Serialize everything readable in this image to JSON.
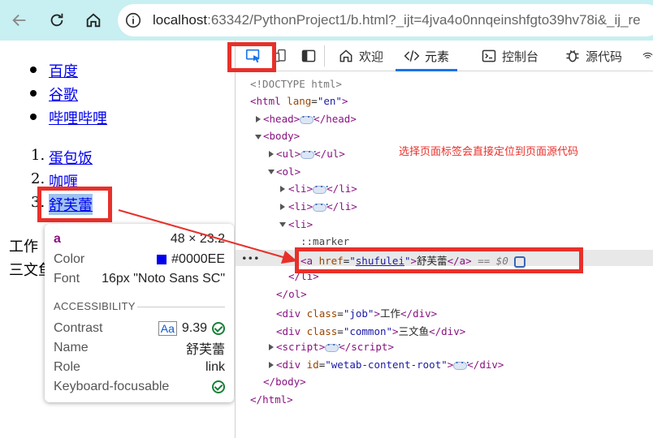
{
  "browser": {
    "url_host": "localhost",
    "url_rest": ":63342/PythonProject1/b.html?_ijt=4jva4o0nnqeinshfgto39hv78i&_ij_re"
  },
  "page": {
    "ul_items": [
      "百度",
      "谷歌",
      "哔哩哔哩"
    ],
    "ol_items": [
      {
        "num": "1.",
        "label": "蛋包饭"
      },
      {
        "num": "2.",
        "label": "咖喱"
      },
      {
        "num": "3.",
        "label": "舒芙蕾"
      }
    ],
    "job_text": "工作",
    "common_text": "三文鱼"
  },
  "tooltip": {
    "tag": "a",
    "size": "48 × 23.2",
    "color_label": "Color",
    "color_value": "#0000EE",
    "font_label": "Font",
    "font_value": "16px \"Noto Sans SC\"",
    "section": "ACCESSIBILITY",
    "contrast_label": "Contrast",
    "contrast_aa": "Aa",
    "contrast_value": "9.39",
    "name_label": "Name",
    "name_value": "舒芙蕾",
    "role_label": "Role",
    "role_value": "link",
    "focus_label": "Keyboard-focusable"
  },
  "devtools": {
    "tabs": [
      {
        "label": "欢迎",
        "icon": "home-icon"
      },
      {
        "label": "元素",
        "icon": "code-icon"
      },
      {
        "label": "控制台",
        "icon": "terminal-icon"
      },
      {
        "label": "源代码",
        "icon": "bug-icon"
      }
    ],
    "annotation": "选择页面标签会直接定位到页面源代码",
    "dom": {
      "doctype": "<!DOCTYPE html>",
      "html_open": "html",
      "lang_attr": "lang",
      "lang_val": "\"en\"",
      "head": "head",
      "body": "body",
      "ul": "ul",
      "ol": "ol",
      "li": "li",
      "marker": "::marker",
      "a_tag": "a",
      "href_attr": "href",
      "href_val": "shufulei",
      "a_text": "舒芙蕾",
      "eq": "== $0",
      "div": "div",
      "class_attr": "class",
      "job_val": "\"job\"",
      "job_text": "工作",
      "common_val": "\"common\"",
      "common_text": "三文鱼",
      "script": "script",
      "id_attr": "id",
      "root_val": "\"wetab-content-root\""
    }
  },
  "colors": {
    "highlight_red": "#e8302a",
    "link_blue": "#0000ee",
    "active_tab_blue": "#1a73e8",
    "topbar": "#c8eff1"
  }
}
